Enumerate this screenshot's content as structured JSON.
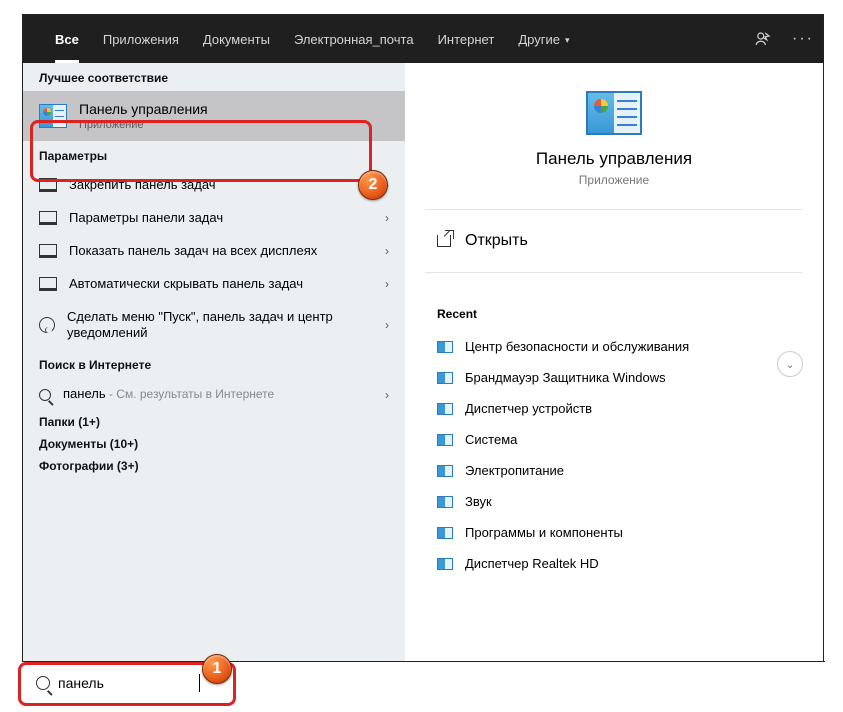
{
  "header": {
    "tabs": [
      "Все",
      "Приложения",
      "Документы",
      "Электронная_почта",
      "Интернет",
      "Другие"
    ]
  },
  "left": {
    "best_match_header": "Лучшее соответствие",
    "best_match": {
      "title": "Панель управления",
      "subtitle": "Приложение"
    },
    "params_header": "Параметры",
    "params": [
      "Закрепить панель задач",
      "Параметры панели задач",
      "Показать панель задач на всех дисплеях",
      "Автоматически скрывать панель задач",
      "Сделать меню \"Пуск\", панель задач и центр уведомлений"
    ],
    "web_header": "Поиск в Интернете",
    "web_query": "панель",
    "web_suffix": " - См. результаты в Интернете",
    "folders": "Папки (1+)",
    "documents": "Документы (10+)",
    "photos": "Фотографии (3+)"
  },
  "right": {
    "title": "Панель управления",
    "subtitle": "Приложение",
    "open": "Открыть",
    "recent_header": "Recent",
    "recent": [
      "Центр безопасности и обслуживания",
      "Брандмауэр Защитника Windows",
      "Диспетчер устройств",
      "Система",
      "Электропитание",
      "Звук",
      "Программы и компоненты",
      "Диспетчер Realtek HD"
    ]
  },
  "search": {
    "value": "панель"
  },
  "annotations": {
    "b1": "1",
    "b2": "2"
  }
}
